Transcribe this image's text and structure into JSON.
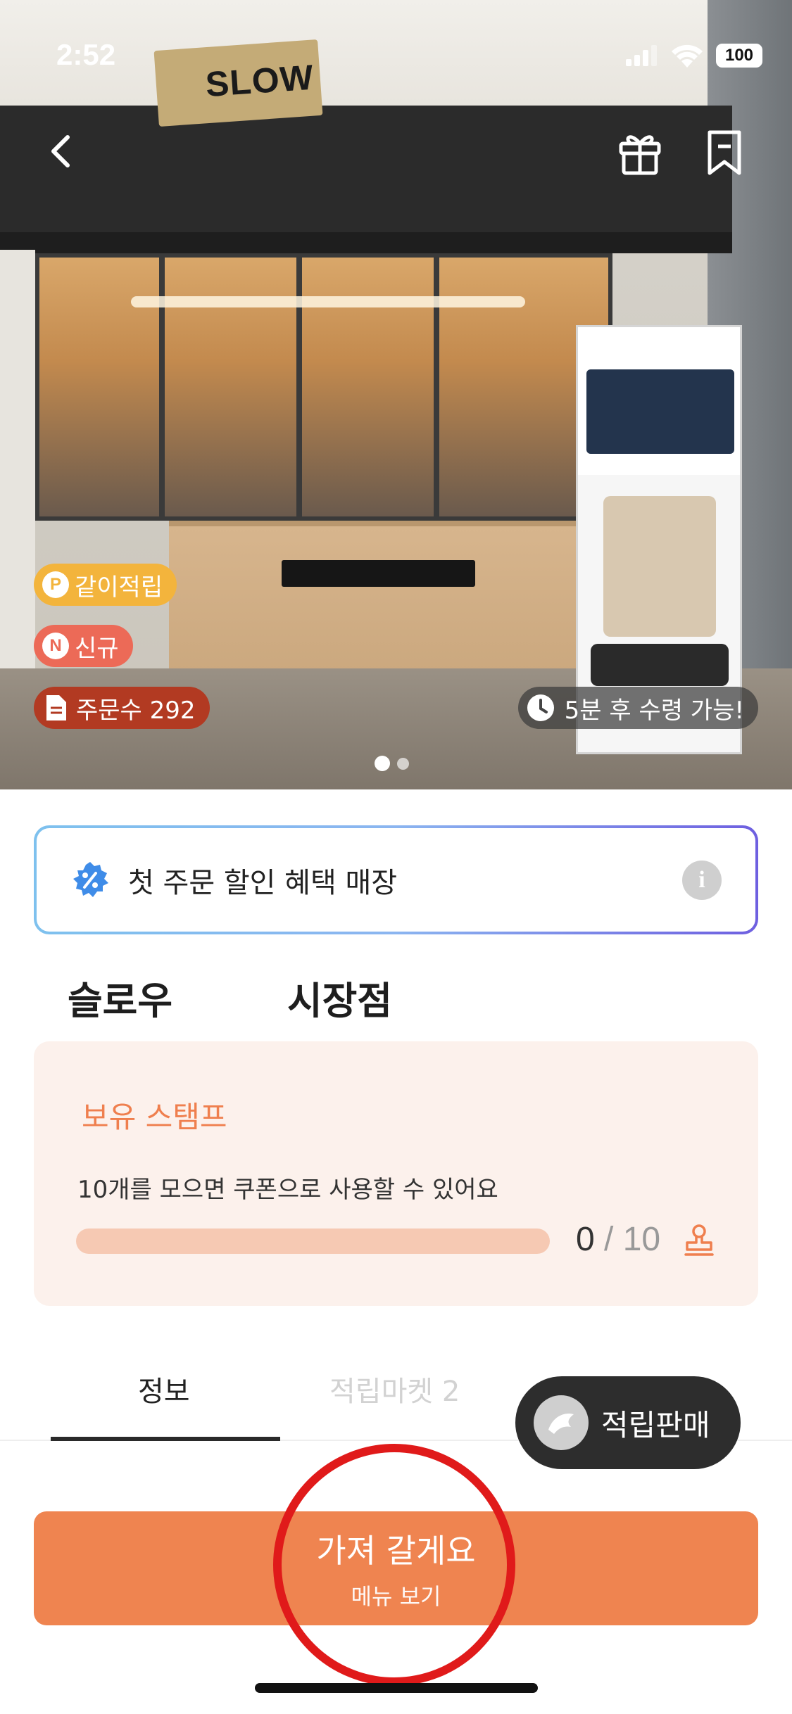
{
  "status_bar": {
    "time": "2:52",
    "battery": "100"
  },
  "hero": {
    "shop_sign": "SLOW",
    "badges": {
      "join_points": {
        "icon_letter": "P",
        "label": "같이적립"
      },
      "new": {
        "icon_letter": "N",
        "label": "신규"
      },
      "orders": {
        "label": "주문수 292"
      }
    },
    "pickup": "5분 후 수령 가능!",
    "carousel": {
      "page": 1,
      "total": 2
    }
  },
  "promo": {
    "text": "첫 주문 할인 혜택 매장",
    "info_icon": "i"
  },
  "store": {
    "name_part1": "슬로우",
    "name_part2": "시장점"
  },
  "stamp": {
    "title": "보유 스탬프",
    "description": "10개를 모으면 쿠폰으로 사용할 수 있어요",
    "current": "0",
    "separator": " / ",
    "total": "10",
    "progress_fraction": 0
  },
  "tabs": {
    "info": "정보",
    "market": "적립마켓 2"
  },
  "sell_button": {
    "label": "적립판매"
  },
  "cta": {
    "main": "가져 갈게요",
    "sub": "메뉴 보기"
  },
  "colors": {
    "accent": "#ef8450",
    "stamp_text": "#ef7f4e",
    "highlight": "#e01a1a"
  }
}
